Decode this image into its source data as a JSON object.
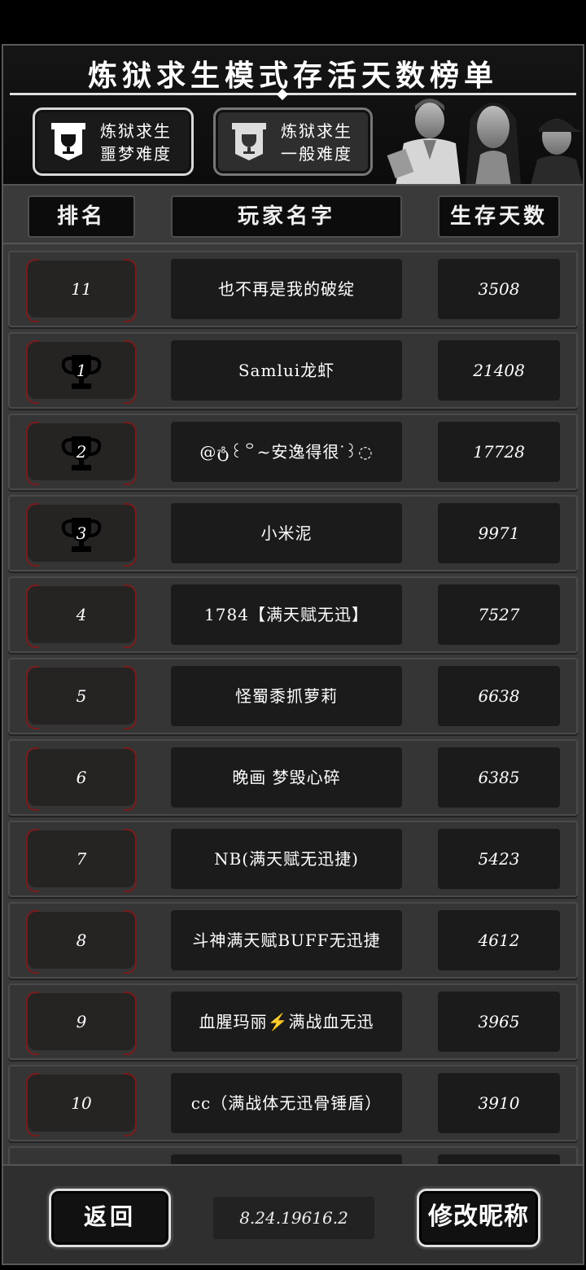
{
  "header": {
    "title": "炼狱求生模式存活天数榜单",
    "difficulty_tabs": [
      {
        "line1": "炼狱求生",
        "line2": "噩梦难度",
        "selected": true
      },
      {
        "line1": "炼狱求生",
        "line2": "一般难度",
        "selected": false
      }
    ]
  },
  "columns": {
    "rank": "排名",
    "name": "玩家名字",
    "days": "生存天数"
  },
  "rows": [
    {
      "rank": "11",
      "name": "也不再是我的破绽",
      "days": "3508",
      "trophy": false
    },
    {
      "rank": "1",
      "name": "Samlui龙虾",
      "days": "21408",
      "trophy": true
    },
    {
      "rank": "2",
      "name": "@ტ꒰꒪~安逸得很ᐝ꒱◌",
      "days": "17728",
      "trophy": true
    },
    {
      "rank": "3",
      "name": "小米泥",
      "days": "9971",
      "trophy": true
    },
    {
      "rank": "4",
      "name": "1784【满天赋无迅】",
      "days": "7527",
      "trophy": false
    },
    {
      "rank": "5",
      "name": "怪蜀黍抓萝莉",
      "days": "6638",
      "trophy": false
    },
    {
      "rank": "6",
      "name": "晚画 梦毁心碎",
      "days": "6385",
      "trophy": false
    },
    {
      "rank": "7",
      "name": "NB(满天赋无迅捷)",
      "days": "5423",
      "trophy": false
    },
    {
      "rank": "8",
      "name": "斗神满天赋BUFF无迅捷",
      "days": "4612",
      "trophy": false
    },
    {
      "rank": "9",
      "name": "血腥玛丽⚡满战血无迅",
      "days": "3965",
      "trophy": false
    },
    {
      "rank": "10",
      "name": "cc（满战体无迅骨锤盾）",
      "days": "3910",
      "trophy": false
    }
  ],
  "footer": {
    "back_label": "返回",
    "version": "8.24.19616.2",
    "rename_label": "修改昵称"
  },
  "colors": {
    "background": "#3a3a3a",
    "cell": "#1b1b1b",
    "rank_border": "#7a1b1b",
    "button_border": "#e0e0e0"
  }
}
